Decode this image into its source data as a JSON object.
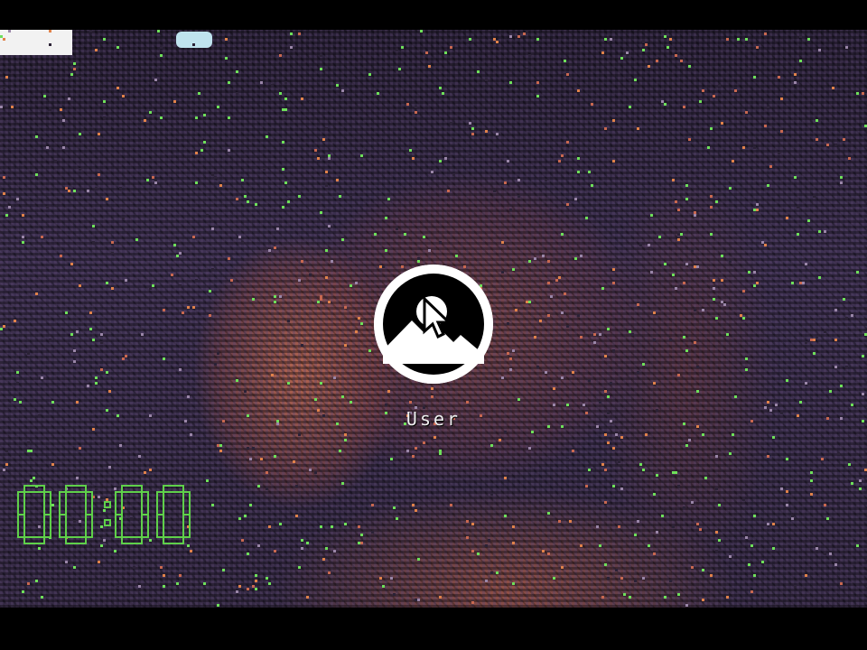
{
  "login": {
    "username": "User"
  },
  "clock": {
    "time": "00:00",
    "color": "#5fd04a"
  },
  "icons": {
    "avatar": "mountain-user-avatar-icon",
    "cursor": "mouse-pointer-icon"
  },
  "colors": {
    "background": "#000000",
    "wallpaper_base": "#3b2f4d",
    "wallpaper_warm": "#b86a52",
    "speckle": "#6ee05a"
  }
}
